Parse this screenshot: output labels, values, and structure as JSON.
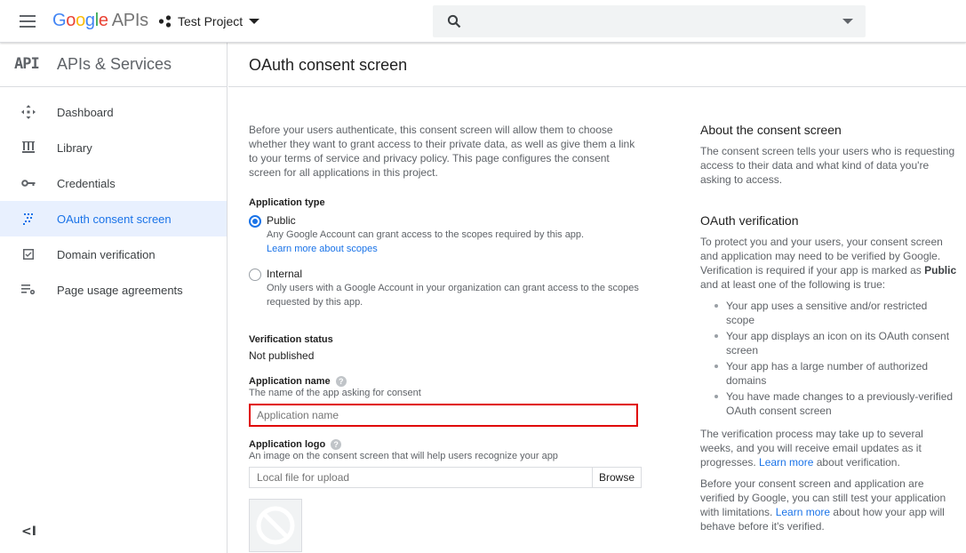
{
  "topbar": {
    "logo_google": "Google",
    "logo_apis": "APIs",
    "project_name": "Test Project",
    "search_placeholder": ""
  },
  "sidebar": {
    "badge": "API",
    "title": "APIs & Services",
    "items": [
      {
        "label": "Dashboard",
        "icon": "dashboard-icon"
      },
      {
        "label": "Library",
        "icon": "library-icon"
      },
      {
        "label": "Credentials",
        "icon": "key-icon"
      },
      {
        "label": "OAuth consent screen",
        "icon": "consent-icon",
        "active": true
      },
      {
        "label": "Domain verification",
        "icon": "checkbox-icon"
      },
      {
        "label": "Page usage agreements",
        "icon": "settings-list-icon"
      }
    ],
    "collapse_glyph": "<I"
  },
  "page": {
    "title": "OAuth consent screen"
  },
  "form": {
    "intro": "Before your users authenticate, this consent screen will allow them to choose whether they want to grant access to their private data, as well as give them a link to your terms of service and privacy policy. This page configures the consent screen for all applications in this project.",
    "app_type_label": "Application type",
    "public_label": "Public",
    "public_desc": "Any Google Account can grant access to the scopes required by this app.",
    "public_link": "Learn more about scopes",
    "internal_label": "Internal",
    "internal_desc": "Only users with a Google Account in your organization can grant access to the scopes requested by this app.",
    "selected_type": "Public",
    "verification_label": "Verification status",
    "verification_value": "Not published",
    "app_name_label": "Application name",
    "app_name_sub": "The name of the app asking for consent",
    "app_name_placeholder": "Application name",
    "app_logo_label": "Application logo",
    "app_logo_sub": "An image on the consent screen that will help users recognize your app",
    "file_placeholder": "Local file for upload",
    "browse_label": "Browse"
  },
  "aside": {
    "about_title": "About the consent screen",
    "about_text": "The consent screen tells your users who is requesting access to their data and what kind of data you're asking to access.",
    "verify_title": "OAuth verification",
    "verify_text_1": "To protect you and your users, your consent screen and application may need to be verified by Google. Verification is required if your app is marked as ",
    "verify_text_bold": "Public",
    "verify_text_2": " and at least one of the following is true:",
    "bullets": [
      "Your app uses a sensitive and/or restricted scope",
      "Your app displays an icon on its OAuth consent screen",
      "Your app has a large number of authorized domains",
      "You have made changes to a previously-verified OAuth consent screen"
    ],
    "process_text_1": "The verification process may take up to several weeks, and you will receive email updates as it progresses. ",
    "process_link": "Learn more",
    "process_text_2": " about verification.",
    "before_text_1": "Before your consent screen and application are verified by Google, you can still test your application with limitations. ",
    "before_link": "Learn more",
    "before_text_2": " about how your app will behave before it's verified."
  },
  "colors": {
    "accent": "#1a73e8",
    "active_bg": "#e8f0fe",
    "highlight_border": "#e00000"
  }
}
